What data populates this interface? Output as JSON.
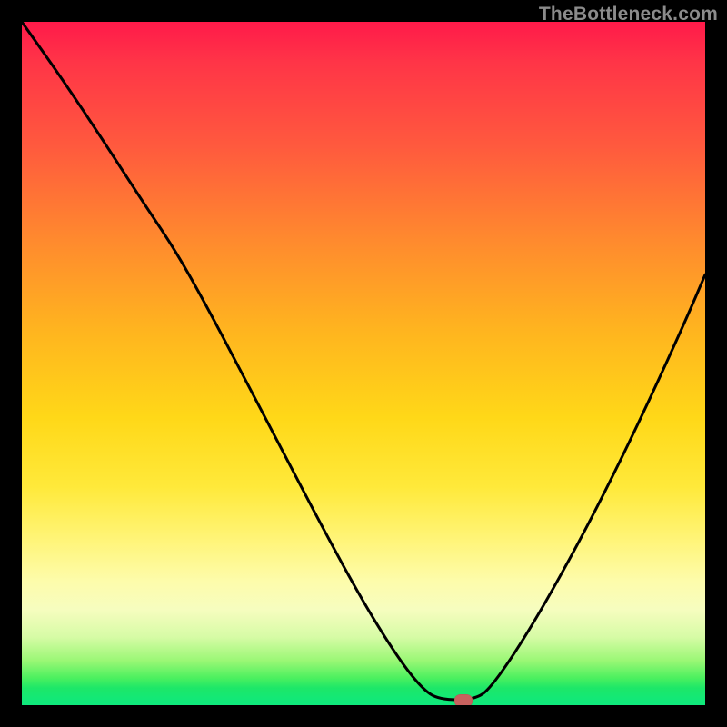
{
  "watermark": "TheBottleneck.com",
  "marker": {
    "x_pct": 64.6,
    "y_pct": 99.3
  },
  "chart_data": {
    "type": "line",
    "title": "",
    "xlabel": "",
    "ylabel": "",
    "xlim": [
      0,
      100
    ],
    "ylim": [
      0,
      100
    ],
    "note": "Axes are unlabeled; values are estimated from pixel positions as percentages of the plot area. y_pct measured from top (0=top, 100=bottom). Background gradient implies lower (greener) is better; curve reaches minimum near x≈64.",
    "series": [
      {
        "name": "bottleneck-curve",
        "points": [
          {
            "x_pct": 0.0,
            "y_pct": 0.0
          },
          {
            "x_pct": 6.0,
            "y_pct": 8.5
          },
          {
            "x_pct": 12.0,
            "y_pct": 17.5
          },
          {
            "x_pct": 18.0,
            "y_pct": 26.8
          },
          {
            "x_pct": 22.5,
            "y_pct": 33.5
          },
          {
            "x_pct": 27.0,
            "y_pct": 41.5
          },
          {
            "x_pct": 32.0,
            "y_pct": 51.0
          },
          {
            "x_pct": 38.0,
            "y_pct": 62.5
          },
          {
            "x_pct": 44.0,
            "y_pct": 74.0
          },
          {
            "x_pct": 50.0,
            "y_pct": 85.0
          },
          {
            "x_pct": 55.0,
            "y_pct": 93.0
          },
          {
            "x_pct": 58.5,
            "y_pct": 97.5
          },
          {
            "x_pct": 61.0,
            "y_pct": 99.2
          },
          {
            "x_pct": 66.5,
            "y_pct": 99.2
          },
          {
            "x_pct": 69.0,
            "y_pct": 97.0
          },
          {
            "x_pct": 74.0,
            "y_pct": 89.5
          },
          {
            "x_pct": 80.0,
            "y_pct": 79.0
          },
          {
            "x_pct": 86.0,
            "y_pct": 67.5
          },
          {
            "x_pct": 92.0,
            "y_pct": 55.0
          },
          {
            "x_pct": 97.0,
            "y_pct": 44.0
          },
          {
            "x_pct": 100.0,
            "y_pct": 37.0
          }
        ]
      }
    ],
    "gradient_stops": [
      {
        "pct": 0,
        "color": "#ff1a4a"
      },
      {
        "pct": 18,
        "color": "#ff593e"
      },
      {
        "pct": 45,
        "color": "#ffb41f"
      },
      {
        "pct": 68,
        "color": "#ffe93a"
      },
      {
        "pct": 86,
        "color": "#f6fdbf"
      },
      {
        "pct": 96,
        "color": "#4cf05f"
      },
      {
        "pct": 100,
        "color": "#0fe87c"
      }
    ]
  }
}
